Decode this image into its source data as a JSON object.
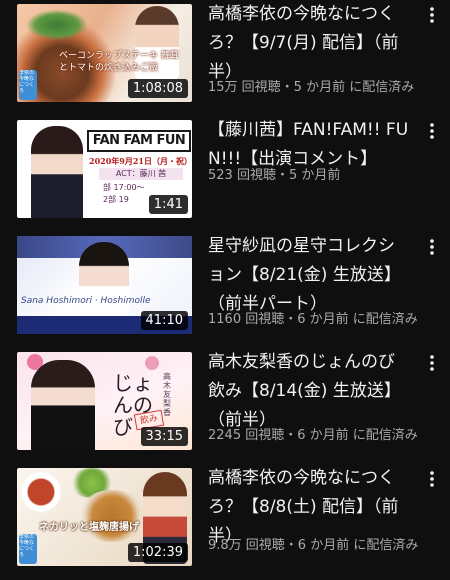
{
  "videos": [
    {
      "title": "高橋李依の今晩なにつくろ？【9/7(月) 配信】（前半）",
      "meta": "15万 回視聴・5 か月前 に配信済み",
      "duration": "1:08:08",
      "thumb_text": "ベーコンラップステーキ 舞茸とトマトの炊き込みご飯",
      "badge": "李依の今晩なにつくろ"
    },
    {
      "title": "【藤川茜】FAN!FAM!! FUN!!!【出演コメント】",
      "meta": "523 回視聴・5 か月前",
      "duration": "1:41",
      "thumb_logo": "FAN FAM FUN",
      "thumb_date": "2020年9月21日（月・祝）",
      "thumb_act": "ACT：藤川 茜",
      "thumb_time1": "部 17:00～",
      "thumb_time2": "2部 19"
    },
    {
      "title": "星守紗凪の星守コレクション【8/21(金) 生放送】（前半パート）",
      "meta": "1160 回視聴・6 か月前 に配信済み",
      "duration": "41:10",
      "thumb_name": "Sana Hoshimori · Hoshimolle"
    },
    {
      "title": "高木友梨香のじょんのび飲み【8/14(金) 生放送】（前半）",
      "meta": "2245 回視聴・6 か月前 に配信済み",
      "duration": "33:15",
      "thumb_text": "じょんのび",
      "thumb_sub": "高木友梨香",
      "thumb_stamp": "飲み"
    },
    {
      "title": "高橋李依の今晩なにつくろ？【8/8(土) 配信】（前半）",
      "meta": "9.8万 回視聴・6 か月前 に配信済み",
      "duration": "1:02:39",
      "thumb_text": "ネカリッと塩麹唐揚げ",
      "badge": "李依の今晩なにつくろ"
    }
  ]
}
